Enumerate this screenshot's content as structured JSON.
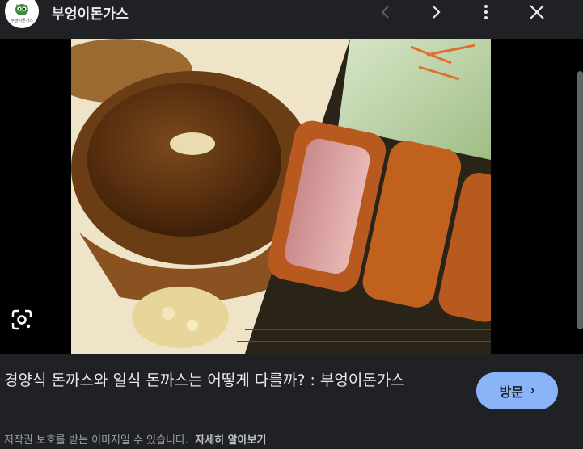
{
  "header": {
    "site_name": "부엉이돈가스",
    "logo_text": "부엉이돈가스",
    "prev_icon": "chevron-left-icon",
    "next_icon": "chevron-right-icon",
    "more_icon": "more-vert-icon",
    "close_icon": "close-icon"
  },
  "image": {
    "lens_icon": "google-lens-icon"
  },
  "caption": {
    "title": "경양식 돈까스와 일식 돈까스는 어떻게 다를까? : 부엉이돈가스",
    "visit_label": "방문",
    "visit_chevron": "›",
    "copyright_text": "저작권 보호를 받는 이미지일 수 있습니다.",
    "learn_more": "자세히 알아보기"
  },
  "colors": {
    "background": "#202124",
    "accent": "#8ab4f8",
    "text": "#e8eaed",
    "muted": "#9aa0a6"
  }
}
